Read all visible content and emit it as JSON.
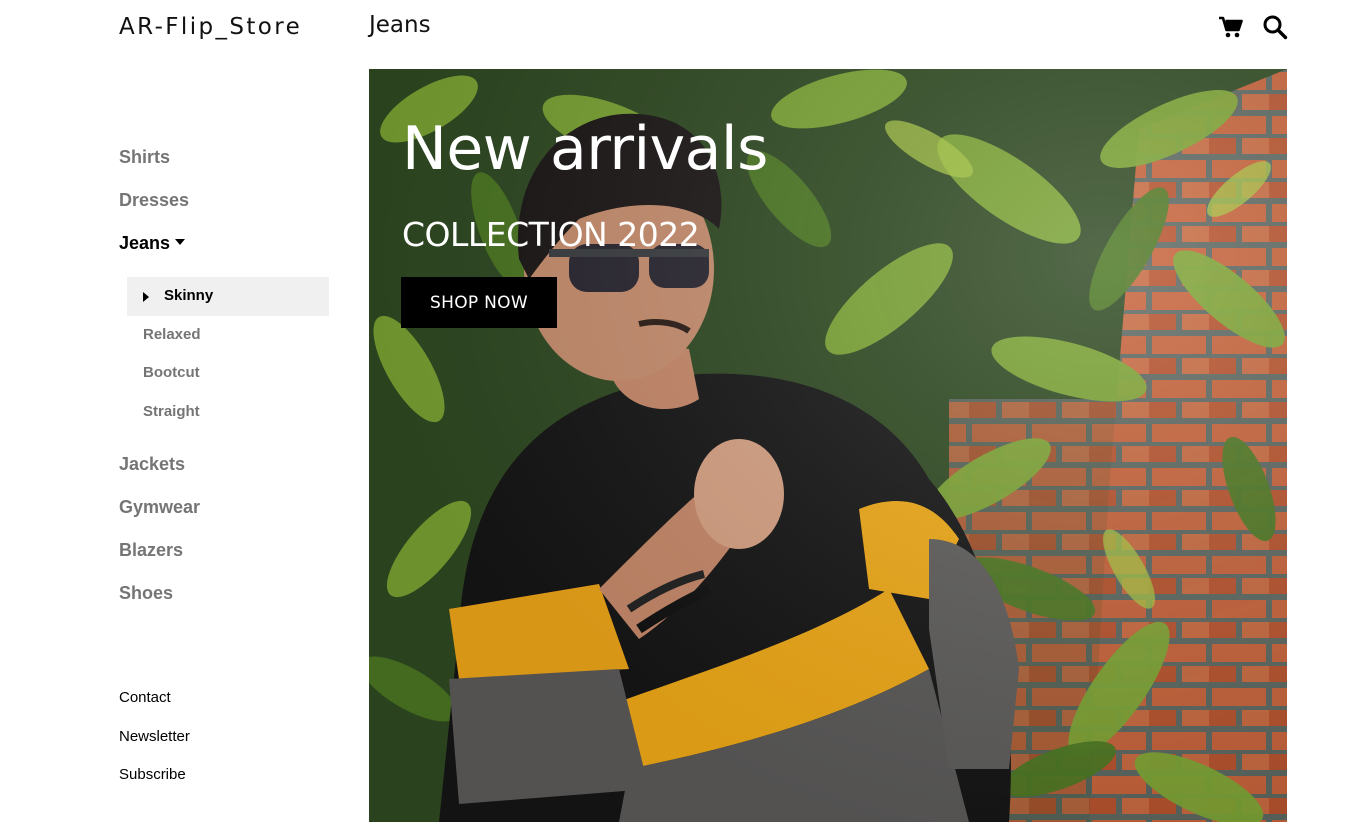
{
  "header": {
    "logo": "AR-Flip_Store",
    "page_title": "Jeans",
    "icons": [
      "shopping-cart-icon",
      "search-icon"
    ]
  },
  "sidebar": {
    "categories": [
      {
        "label": "Shirts"
      },
      {
        "label": "Dresses"
      },
      {
        "label": "Jeans",
        "active": true
      },
      {
        "label": "Jackets"
      },
      {
        "label": "Gymwear"
      },
      {
        "label": "Blazers"
      },
      {
        "label": "Shoes"
      }
    ],
    "jeans_subcategories": [
      {
        "label": "Skinny",
        "active": true
      },
      {
        "label": "Relaxed"
      },
      {
        "label": "Bootcut"
      },
      {
        "label": "Straight"
      }
    ],
    "footer_links": [
      {
        "label": "Contact"
      },
      {
        "label": "Newsletter"
      },
      {
        "label": "Subscribe"
      }
    ]
  },
  "hero": {
    "title": "New arrivals",
    "subtitle": "COLLECTION 2022",
    "button_label": "SHOP NOW"
  },
  "colors": {
    "active_text": "#000000",
    "inactive_text": "#757575",
    "active_sub_bg": "#f0f0f0",
    "button_bg": "#000000"
  }
}
